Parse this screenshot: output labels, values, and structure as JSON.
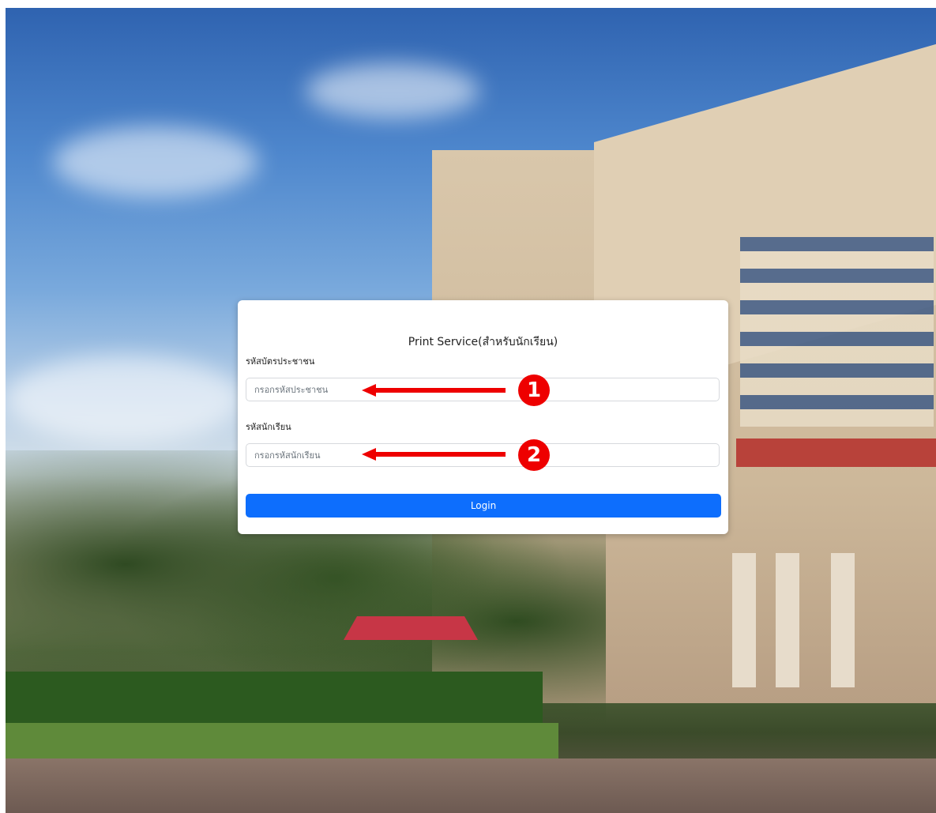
{
  "login": {
    "title": "Print Service(สำหรับนักเรียน)",
    "citizen_id_label": "รหัสบัตรประชาชน",
    "citizen_id_placeholder": "กรอกรหัสประชาชน",
    "student_id_label": "รหัสนักเรียน",
    "student_id_placeholder": "กรอกรหัสนักเรียน",
    "login_label": "Login"
  },
  "annotations": {
    "badge1": "1",
    "badge2": "2",
    "color": "#ee0000"
  },
  "colors": {
    "primary": "#0d6efd"
  }
}
